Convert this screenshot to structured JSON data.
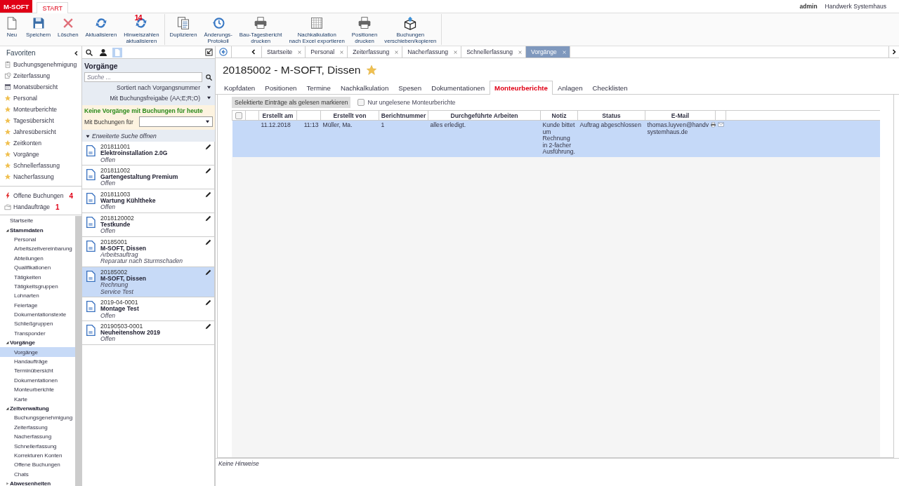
{
  "app": {
    "logo": "M-SOFT",
    "tab": "START",
    "user": "admin",
    "company": "Handwerk Systemhaus"
  },
  "ribbon": {
    "groups": [
      {
        "buttons": [
          {
            "kind": "new",
            "label": "Neu"
          },
          {
            "kind": "save",
            "label": "Speichern"
          },
          {
            "kind": "delete",
            "label": "Löschen"
          },
          {
            "kind": "refresh",
            "label": "Aktualisieren"
          },
          {
            "kind": "refresh",
            "label": "Hinweiszahlen\naktualisieren",
            "badge": "14"
          }
        ]
      },
      {
        "buttons": [
          {
            "kind": "copy",
            "label": "Duplizieren"
          },
          {
            "kind": "history",
            "label": "Änderungs-\nProtokoll"
          },
          {
            "kind": "print",
            "label": "Bau-Tagesbericht\ndrucken"
          },
          {
            "kind": "grid",
            "label": "Nachkalkulation\nnach Excel exportieren"
          },
          {
            "kind": "print",
            "label": "Positionen\ndrucken"
          },
          {
            "kind": "box",
            "label": "Buchungen\nverschieben/kopieren"
          }
        ]
      }
    ]
  },
  "favorites": {
    "title": "Favoriten",
    "items": [
      {
        "kind": "clipboard",
        "label": "Buchungsgenehmigung"
      },
      {
        "kind": "clock",
        "label": "Zeiterfassung"
      },
      {
        "kind": "calendar",
        "label": "Monatsübersicht"
      },
      {
        "kind": "star",
        "label": "Personal"
      },
      {
        "kind": "star",
        "label": "Monteurberichte"
      },
      {
        "kind": "star",
        "label": "Tagesübersicht"
      },
      {
        "kind": "star",
        "label": "Jahresübersicht"
      },
      {
        "kind": "star",
        "label": "Zeitkonten"
      },
      {
        "kind": "star",
        "label": "Vorgänge"
      },
      {
        "kind": "star",
        "label": "Schnellerfassung"
      },
      {
        "kind": "star",
        "label": "Nacherfassung"
      }
    ]
  },
  "quick": [
    {
      "kind": "bolt",
      "label": "Offene Buchungen",
      "count": "4"
    },
    {
      "kind": "folder",
      "label": "Handaufträge",
      "count": "1"
    }
  ],
  "tree": [
    {
      "label": "Startseite",
      "selected": false
    },
    {
      "label": "Stammdaten",
      "selected": false,
      "expanded": true,
      "children": [
        {
          "label": "Personal",
          "selected": false
        },
        {
          "label": "Arbeitszeitvereinbarung",
          "selected": false
        },
        {
          "label": "Abteilungen",
          "selected": false
        },
        {
          "label": "Qualifikationen",
          "selected": false
        },
        {
          "label": "Tätigkeiten",
          "selected": false
        },
        {
          "label": "Tätigkeitsgruppen",
          "selected": false
        },
        {
          "label": "Lohnarten",
          "selected": false
        },
        {
          "label": "Feiertage",
          "selected": false
        },
        {
          "label": "Dokumentationstexte",
          "selected": false
        },
        {
          "label": "Schließgruppen",
          "selected": false
        },
        {
          "label": "Transponder",
          "selected": false
        }
      ]
    },
    {
      "label": "Vorgänge",
      "selected": false,
      "expanded": true,
      "children": [
        {
          "label": "Vorgänge",
          "selected": true
        },
        {
          "label": "Handaufträge",
          "selected": false
        },
        {
          "label": "Terminübersicht",
          "selected": false
        },
        {
          "label": "Dokumentationen",
          "selected": false
        },
        {
          "label": "Monteurberichte",
          "selected": false
        },
        {
          "label": "Karte",
          "selected": false
        }
      ]
    },
    {
      "label": "Zeitverwaltung",
      "selected": false,
      "expanded": true,
      "children": [
        {
          "label": "Buchungsgenehmigung",
          "selected": false
        },
        {
          "label": "Zeiterfassung",
          "selected": false
        },
        {
          "label": "Nacherfassung",
          "selected": false
        },
        {
          "label": "Schnellerfassung",
          "selected": false
        },
        {
          "label": "Korrekturen Konten",
          "selected": false
        },
        {
          "label": "Offene Buchungen",
          "selected": false
        },
        {
          "label": "Chats",
          "selected": false
        }
      ]
    },
    {
      "label": "Abwesenheiten",
      "selected": false,
      "expanded": false
    }
  ],
  "list_panel": {
    "tools": [
      {
        "kind": "search",
        "selected": false
      },
      {
        "kind": "person",
        "selected": false
      },
      {
        "kind": "document",
        "selected": true
      }
    ],
    "title": "Vorgänge",
    "search_placeholder": "Suche ...",
    "sort": "Sortiert nach Vorgangsnummer",
    "filter": "Mit Buchungsfreigabe (AA;E;R;O)",
    "notice": "Keine Vorgänge mit Buchungen für heute",
    "date_label": "Mit Buchungen für",
    "extended": "Erweiterte Suche öffnen",
    "items": [
      {
        "number": "201811001",
        "name": "Elektroinstallation 2.0G",
        "lines": [
          "Offen"
        ],
        "selected": false
      },
      {
        "number": "201811002",
        "name": "Gartengestaltung Premium",
        "lines": [
          "Offen"
        ],
        "selected": false
      },
      {
        "number": "201811003",
        "name": "Wartung Kühltheke",
        "lines": [
          "Offen"
        ],
        "selected": false
      },
      {
        "number": "2018120002",
        "name": "Testkunde",
        "lines": [
          "Offen"
        ],
        "selected": false
      },
      {
        "number": "20185001",
        "name": "M-SOFT, Dissen",
        "lines": [
          "Arbeitsauftrag",
          "Reparatur nach Sturmschaden"
        ],
        "selected": false
      },
      {
        "number": "20185002",
        "name": "M-SOFT, Dissen",
        "lines": [
          "Rechnung",
          "Service Test"
        ],
        "selected": true
      },
      {
        "number": "2019-04-0001",
        "name": "Montage Test",
        "lines": [
          "Offen"
        ],
        "selected": false
      },
      {
        "number": "20190503-0001",
        "name": "Neuheitenshow 2019",
        "lines": [
          "Offen"
        ],
        "selected": false
      }
    ]
  },
  "tabs": [
    {
      "label": "Startseite",
      "selected": false
    },
    {
      "label": "Personal",
      "selected": false
    },
    {
      "label": "Zeiterfassung",
      "selected": false
    },
    {
      "label": "Nacherfassung",
      "selected": false
    },
    {
      "label": "Schnellerfassung",
      "selected": false
    },
    {
      "label": "Vorgänge",
      "selected": true
    }
  ],
  "record": {
    "title": "20185002 - M-SOFT, Dissen",
    "favorite": true,
    "tabs": [
      {
        "label": "Kopfdaten",
        "selected": false
      },
      {
        "label": "Positionen",
        "selected": false
      },
      {
        "label": "Termine",
        "selected": false
      },
      {
        "label": "Nachkalkulation",
        "selected": false
      },
      {
        "label": "Spesen",
        "selected": false
      },
      {
        "label": "Dokumentationen",
        "selected": false
      },
      {
        "label": "Monteurberichte",
        "selected": true
      },
      {
        "label": "Anlagen",
        "selected": false
      },
      {
        "label": "Checklisten",
        "selected": false
      }
    ],
    "mark_button": "Selektierte Einträge als gelesen markieren",
    "unread_filter": {
      "label": "Nur ungelesene Monteurberichte",
      "checked": false
    },
    "table": {
      "select_all": false,
      "columns": [
        {
          "kind": "check"
        },
        {
          "kind": "blank"
        },
        {
          "kind": "text",
          "label": "Erstellt am"
        },
        {
          "kind": "blank"
        },
        {
          "kind": "text",
          "label": "Erstellt von"
        },
        {
          "kind": "text",
          "label": "Berichtnummer"
        },
        {
          "kind": "text",
          "label": "Durchgeführte Arbeiten"
        },
        {
          "kind": "text",
          "label": "Notiz"
        },
        {
          "kind": "text",
          "label": "Status"
        },
        {
          "kind": "text",
          "label": "E-Mail"
        },
        {
          "kind": "blank"
        }
      ],
      "rows": [
        {
          "selected": true,
          "cells": [
            "",
            "",
            "11.12.2018",
            "11:13",
            "Müller, Ma.",
            "1",
            "alles erledigt.",
            "Kunde bittet um Rechnung in 2-facher Ausführung.",
            "Auftrag abgeschlossen"
          ],
          "email": [
            "thomas.luyven@handv",
            "systemhaus.de"
          ]
        }
      ]
    }
  },
  "status": "Keine Hinweise"
}
